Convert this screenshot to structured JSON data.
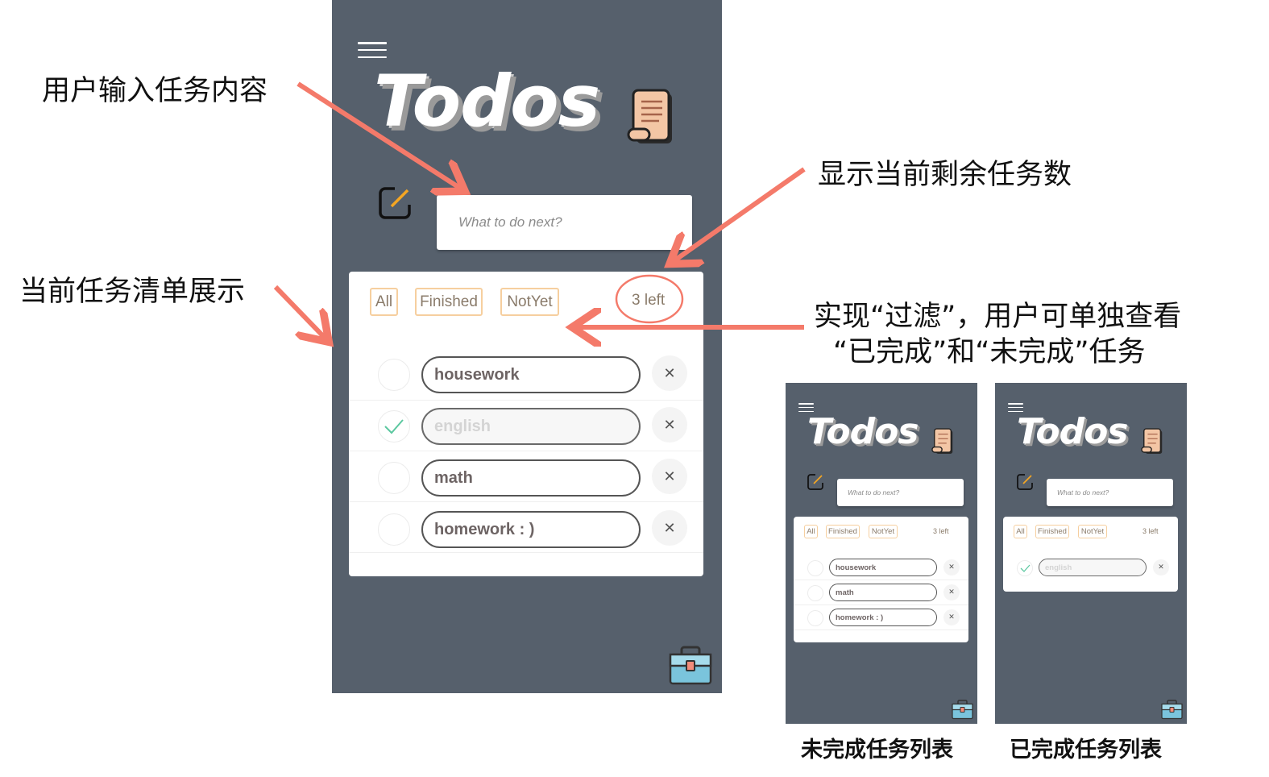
{
  "app": {
    "title": "Todos",
    "input_placeholder": "What to do next?",
    "filters": {
      "all": "All",
      "finished": "Finished",
      "notyet": "NotYet"
    },
    "left_count": "3 left",
    "delete_glyph": "✕",
    "check_glyph": "✓"
  },
  "main_todos": [
    {
      "text": "housework",
      "done": false
    },
    {
      "text": "english",
      "done": true
    },
    {
      "text": "math",
      "done": false
    },
    {
      "text": "homework : )",
      "done": false
    }
  ],
  "notyet_todos": [
    {
      "text": "housework"
    },
    {
      "text": "math"
    },
    {
      "text": "homework : )"
    }
  ],
  "finished_todos": [
    {
      "text": "english"
    }
  ],
  "annotations": {
    "input": "用户输入任务内容",
    "remaining": "显示当前剩余任务数",
    "list": "当前任务清单展示",
    "filter_line1": "实现“过滤”，用户可单独查看",
    "filter_line2": "“已完成”和“未完成”任务",
    "caption_notyet": "未完成任务列表",
    "caption_finished": "已完成任务列表"
  },
  "colors": {
    "background": "#56606c",
    "accent_filter": "#f6cf9f",
    "arrow": "#f47a6a",
    "check": "#5cc8a0"
  },
  "icons": [
    "hamburger-menu-icon",
    "scroll-icon",
    "edit-icon",
    "close-icon",
    "check-icon",
    "toolbox-icon"
  ]
}
